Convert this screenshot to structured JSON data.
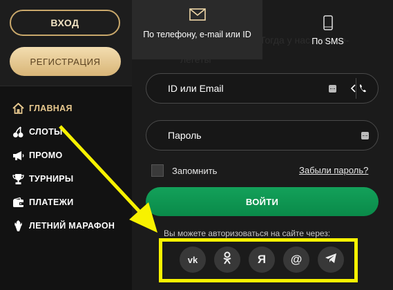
{
  "sidebar": {
    "login_label": "ВХОД",
    "register_label": "РЕГИСТРАЦИЯ",
    "items": [
      {
        "label": "ГЛАВНАЯ",
        "icon": "home-icon",
        "active": true
      },
      {
        "label": "СЛОТЫ",
        "icon": "cherries-icon"
      },
      {
        "label": "ПРОМО",
        "icon": "megaphone-icon"
      },
      {
        "label": "ТУРНИРЫ",
        "icon": "trophy-icon"
      },
      {
        "label": "ПЛАТЕЖИ",
        "icon": "wallet-icon"
      },
      {
        "label": "ЛЕТНИЙ МАРАФОН",
        "icon": "torch-icon"
      }
    ]
  },
  "tabs": [
    {
      "label": "По телефону, e-mail или ID",
      "icon": "envelope-icon",
      "active": true
    },
    {
      "label": "По SMS",
      "icon": "phone-icon",
      "active": false
    }
  ],
  "background_text": {
    "line1": "Тогда у нас вас кое-",
    "line2": "легеты"
  },
  "form": {
    "login_placeholder": "ID или Email",
    "password_placeholder": "Пароль",
    "remember_label": "Запомнить",
    "forgot_label": "Забыли пароль?",
    "submit_label": "ВОЙТИ",
    "social_prompt": "Вы можете авторизоваться на сайте через:",
    "social": [
      {
        "label": "vk",
        "icon": "vk-icon"
      },
      {
        "label": "ok",
        "icon": "odnoklassniki-icon"
      },
      {
        "label": "Я",
        "icon": "yandex-icon"
      },
      {
        "label": "@",
        "icon": "mailru-icon"
      },
      {
        "label": "",
        "icon": "telegram-icon"
      }
    ]
  },
  "colors": {
    "accent_gold": "#e7c88e",
    "submit_green": "#10994f",
    "annotation_yellow": "#f8f200"
  }
}
